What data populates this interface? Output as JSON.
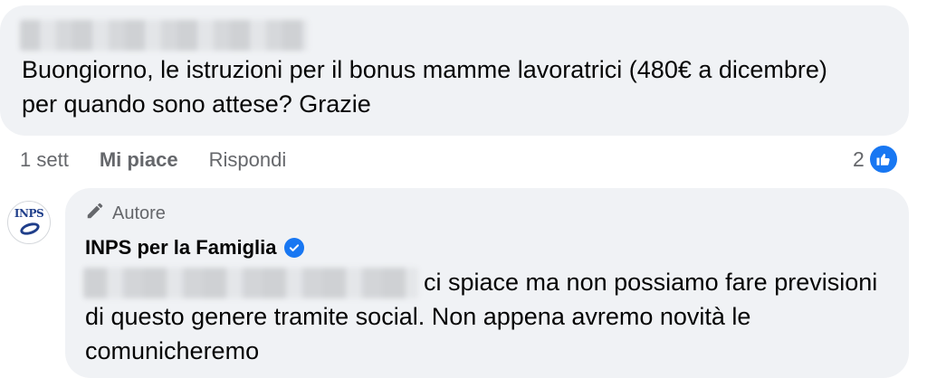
{
  "comment": {
    "text": "Buongiorno, le istruzioni per il bonus mamme lavoratrici (480€ a dicembre) per quando sono attese? Grazie",
    "time": "1 sett",
    "like_label": "Mi piace",
    "reply_label": "Rispondi",
    "reaction_count": "2",
    "reaction_icon": "thumbs-up-icon",
    "accent_color": "#1877f2"
  },
  "reply": {
    "author_badge": "Autore",
    "author_icon": "pencil-icon",
    "page_name": "INPS per la Famiglia",
    "avatar_label": "INPS",
    "verified_icon": "verified-check-icon",
    "text": "ci spiace ma non possiamo fare previsioni di questo genere tramite social. Non appena avremo novità le comunicheremo"
  }
}
